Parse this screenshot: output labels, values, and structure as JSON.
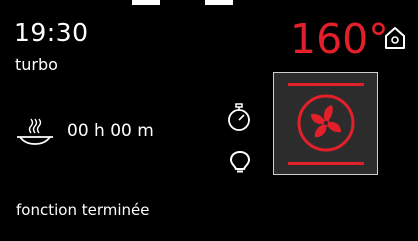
{
  "screen": {
    "time": "19:30",
    "mode": "turbo",
    "temperature": "160°",
    "duration": "00 h 00 m",
    "status": "fonction terminée"
  },
  "icons": {
    "home": "home-icon",
    "steam": "steam-dish-icon",
    "timer": "stopwatch-icon",
    "lamp": "lamp-icon",
    "fan": "turbo-fan-icon"
  },
  "colors": {
    "background": "#000000",
    "accent": "#e3202a",
    "text": "#ffffff",
    "tile": "#2c2c2c"
  }
}
